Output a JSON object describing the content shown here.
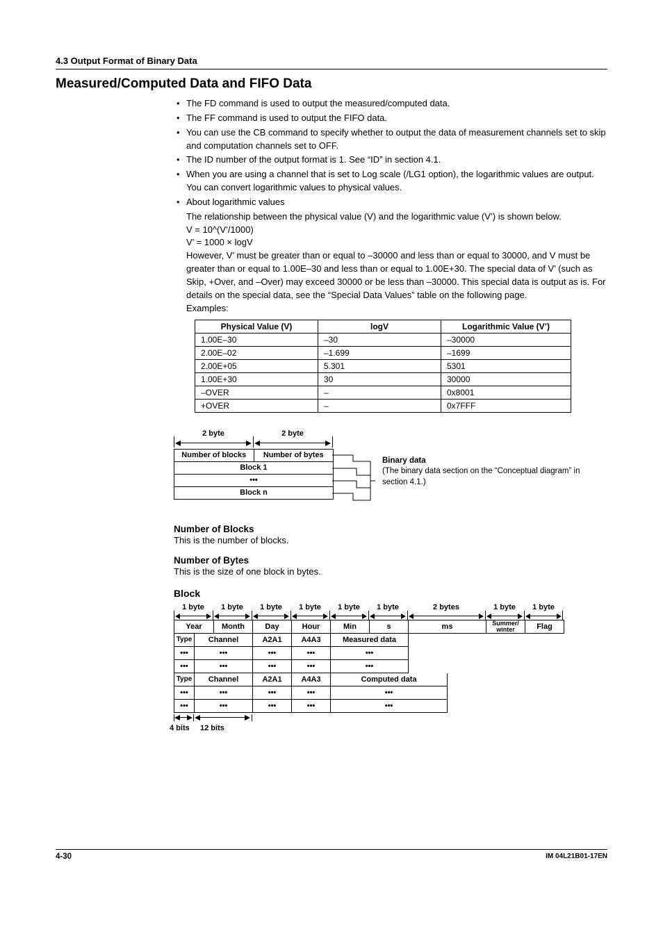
{
  "header": {
    "section": "4.3  Output Format of Binary Data"
  },
  "title": "Measured/Computed Data and FIFO Data",
  "bullets": [
    "The FD command is used to output the measured/computed data.",
    "The FF command is used to output the FIFO data.",
    "You can use the CB command to specify whether to output the data of measurement channels set to skip and computation channels set to OFF.",
    "The ID number of the output format is 1. See “ID” in section 4.1.",
    "When you are using a channel that is set to Log scale (/LG1 option), the logarithmic values are output. You can convert logarithmic values to physical values.",
    "About logarithmic values"
  ],
  "log": {
    "intro": "The relationship between the physical value (V) and the logarithmic value (V’) is shown below.",
    "eq1": "V = 10^(V’/1000)",
    "eq2": "V’ = 1000 × logV",
    "note": "However, V’ must be greater than or equal to –30000 and less than or equal to 30000, and V must be greater than or equal to 1.00E–30 and less than or equal to 1.00E+30. The special data of V’ (such as Skip, +Over, and –Over) may exceed 30000 or be less than –30000. This special data is output as is. For details on the special data, see the “Special Data Values” table on the following page.",
    "examples": "Examples:"
  },
  "table": {
    "headers": [
      "Physical Value (V)",
      "logV",
      "Logarithmic Value (V’)"
    ],
    "rows": [
      [
        "1.00E–30",
        "–30",
        "–30000"
      ],
      [
        "2.00E–02",
        "–1.699",
        "–1699"
      ],
      [
        "2.00E+05",
        "5.301",
        "5301"
      ],
      [
        "1.00E+30",
        "30",
        "30000"
      ],
      [
        "–OVER",
        "–",
        "0x8001"
      ],
      [
        "+OVER",
        "–",
        "0x7FFF"
      ]
    ]
  },
  "diag1": {
    "dim1": "2 byte",
    "dim2": "2 byte",
    "cells": [
      "Number of blocks",
      "Number of bytes",
      "Block 1",
      "•••",
      "Block n"
    ],
    "label_title": "Binary data",
    "label_body": "(The binary data section on the “Conceptual diagram” in section 4.1.)"
  },
  "sections": {
    "nblocks_h": "Number of Blocks",
    "nblocks_b": "This is the number of blocks.",
    "nbytes_h": "Number of Bytes",
    "nbytes_b": "This is the size of one block in bytes.",
    "block_h": "Block"
  },
  "block": {
    "bytes": [
      "1 byte",
      "1 byte",
      "1 byte",
      "1 byte",
      "1 byte",
      "1 byte",
      "2 bytes",
      "1 byte",
      "1 byte"
    ],
    "row1": [
      "Year",
      "Month",
      "Day",
      "Hour",
      "Min",
      "s",
      "ms",
      "Summer/\nwinter",
      "Flag"
    ],
    "row2": [
      "Type",
      "Channel",
      "A2A1",
      "A4A3",
      "Measured data"
    ],
    "row3": [
      "•••",
      "•••",
      "•••",
      "•••",
      "•••"
    ],
    "row5": [
      "Type",
      "Channel",
      "A2A1",
      "A4A3",
      "Computed data"
    ],
    "bits4": "4 bits",
    "bits12": "12 bits"
  },
  "footer": {
    "page": "4-30",
    "doc": "IM 04L21B01-17EN"
  }
}
